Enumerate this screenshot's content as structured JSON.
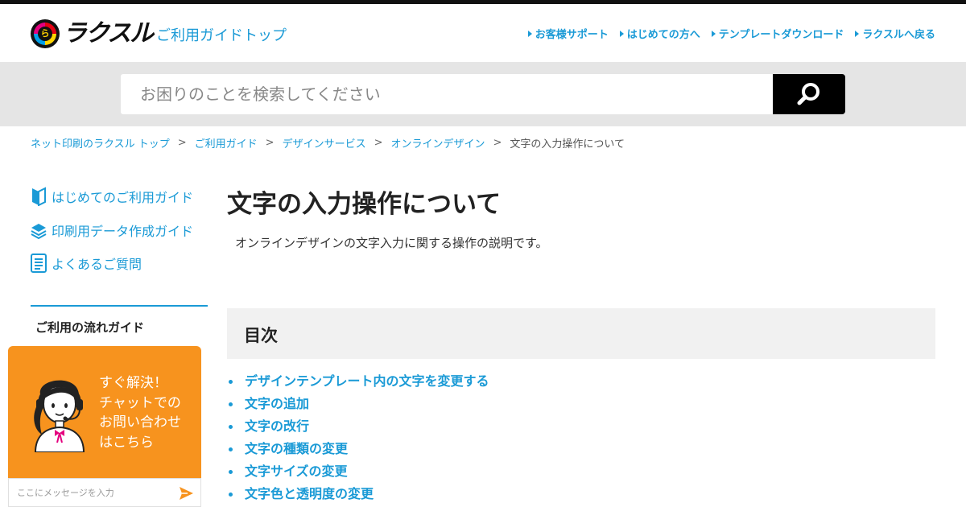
{
  "header": {
    "logo_mark": "ら",
    "logo_text": "ラクスル",
    "guide_top": "ご利用ガイドトップ",
    "nav": [
      {
        "label": "お客様サポート"
      },
      {
        "label": "はじめての方へ"
      },
      {
        "label": "テンプレートダウンロード"
      },
      {
        "label": "ラクスルへ戻る"
      }
    ]
  },
  "search": {
    "placeholder": "お困りのことを検索してください",
    "value": "",
    "button_icon": "search-icon"
  },
  "breadcrumb": {
    "items": [
      {
        "label": "ネット印刷のラクスル トップ"
      },
      {
        "label": "ご利用ガイド"
      },
      {
        "label": "デザインサービス"
      },
      {
        "label": "オンラインデザイン"
      }
    ],
    "separator": ">",
    "current": "文字の入力操作について"
  },
  "sidebar": {
    "links": [
      {
        "label": "はじめてのご利用ガイド",
        "icon": "beginner-mark-icon"
      },
      {
        "label": "印刷用データ作成ガイド",
        "icon": "stack-icon"
      },
      {
        "label": "よくあるご質問",
        "icon": "faq-document-icon"
      }
    ],
    "section_heading": "ご利用の流れガイド"
  },
  "main": {
    "title": "文字の入力操作について",
    "description": "オンラインデザインの文字入力に関する操作の説明です。",
    "toc_title": "目次",
    "toc": [
      {
        "label": "デザインテンプレート内の文字を変更する"
      },
      {
        "label": "文字の追加"
      },
      {
        "label": "文字の改行"
      },
      {
        "label": "文字の種類の変更"
      },
      {
        "label": "文字サイズの変更"
      },
      {
        "label": "文字色と透明度の変更"
      }
    ]
  },
  "chat": {
    "lines": [
      "すぐ解決！",
      "チャットでの",
      "お問い合わせ",
      "はこちら"
    ],
    "input_placeholder": "ここにメッセージを入力",
    "input_value": "",
    "send_icon": "send-icon"
  },
  "colors": {
    "link": "#1a9ad6",
    "chat_bg": "#f7931e",
    "search_band": "#e5e5e5",
    "search_button": "#000000",
    "toc_bg": "#f1f1f1"
  }
}
